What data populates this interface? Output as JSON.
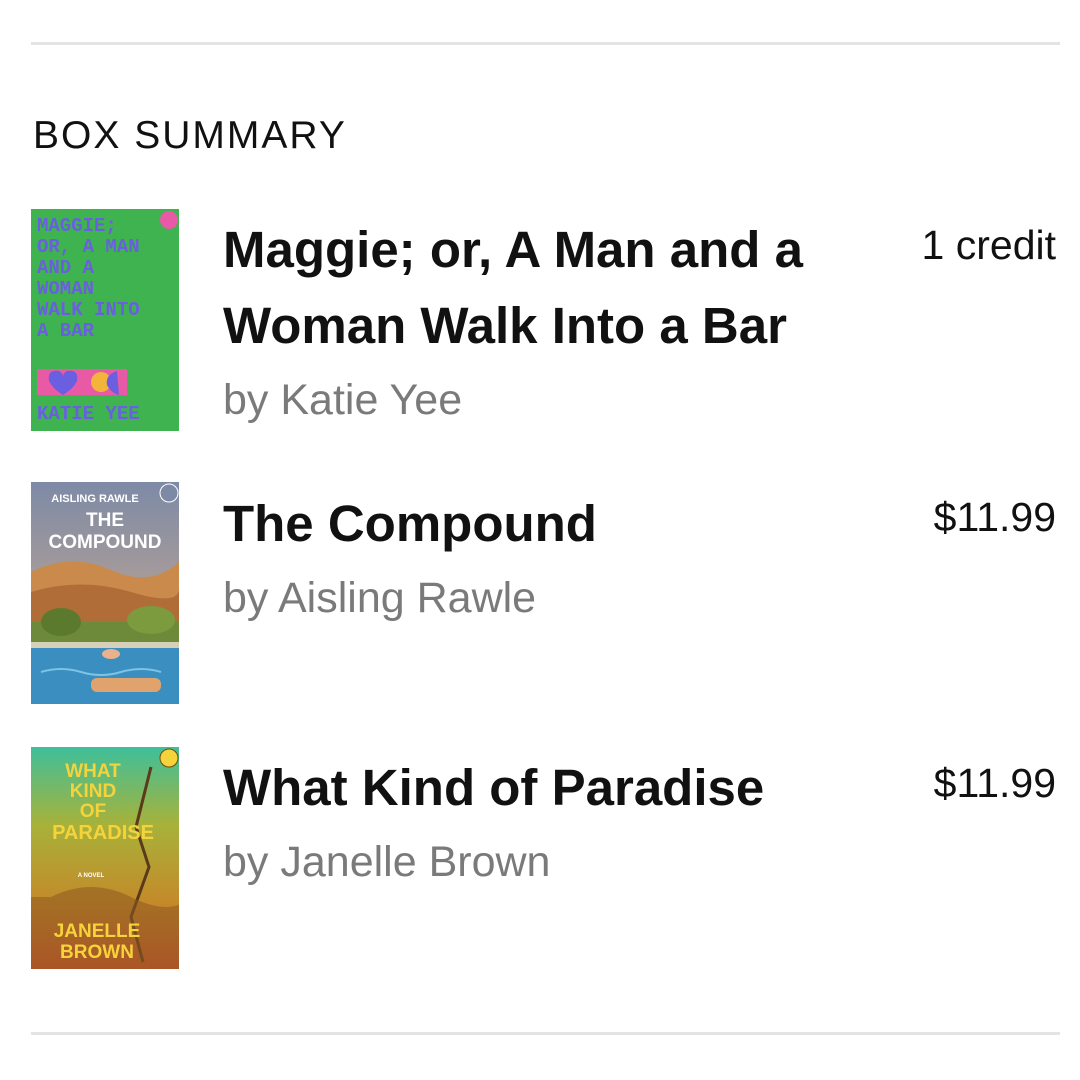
{
  "section": {
    "title": "BOX SUMMARY"
  },
  "items": [
    {
      "title": "Maggie; or, A Man and a Woman Walk Into a Bar",
      "author": "by Katie Yee",
      "price": "1 credit",
      "cover": {
        "lines": [
          "MAGGIE;",
          "OR, A MAN",
          "AND A",
          "WOMAN",
          "WALK INTO",
          "A BAR"
        ],
        "author": "KATIE YEE",
        "colors": {
          "bg": "#3fb34f",
          "text": "#6a5fe0",
          "accent": "#e85aa5"
        }
      }
    },
    {
      "title": "The Compound",
      "author": "by Aisling Rawle",
      "price": "$11.99",
      "cover": {
        "author": "AISLING RAWLE",
        "lines": [
          "THE",
          "COMPOUND"
        ],
        "colors": {
          "sky": "#8c9ab3",
          "desert": "#c98a4c",
          "pool": "#3a8fc0"
        }
      }
    },
    {
      "title": "What Kind of Paradise",
      "author": "by Janelle Brown",
      "price": "$11.99",
      "cover": {
        "lines": [
          "WHAT",
          "KIND",
          "OF",
          "PARADISE"
        ],
        "tag": "A NOVEL",
        "author_lines": [
          "JANELLE",
          "BROWN"
        ],
        "colors": {
          "top": "#3fbf9a",
          "mid": "#c48a2a",
          "text": "#f5d33a"
        }
      }
    }
  ]
}
